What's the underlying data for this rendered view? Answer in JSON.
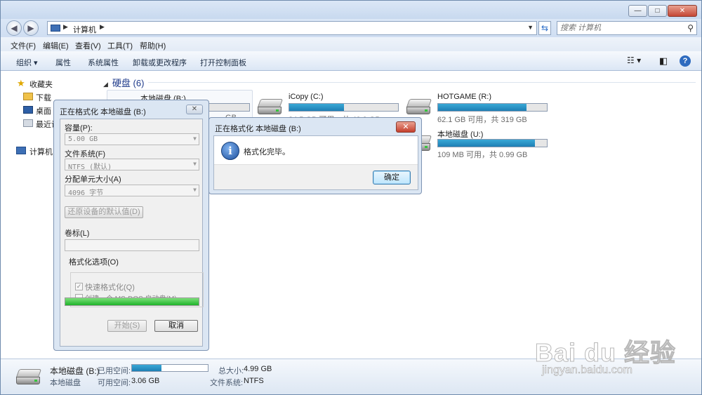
{
  "window": {
    "buttons": {
      "minimize": "—",
      "maximize": "□",
      "close": "✕"
    }
  },
  "address": {
    "path": "计算机",
    "search_placeholder": "搜索 计算机"
  },
  "menu": [
    "文件(F)",
    "编辑(E)",
    "查看(V)",
    "工具(T)",
    "帮助(H)"
  ],
  "toolbar": [
    "组织 ▾",
    "属性",
    "系统属性",
    "卸载或更改程序",
    "打开控制面板"
  ],
  "sidebar": {
    "favorites": "收藏夹",
    "items": [
      "下载",
      "桌面",
      "最近访"
    ],
    "computer": "计算机"
  },
  "group": {
    "title": "硬盘 (6)"
  },
  "drives": [
    {
      "name": "本地磁盘 (B:)",
      "usage": 0.0,
      "subtitle": "… GB"
    },
    {
      "name": "iCopy (C:)",
      "usage": 0.5,
      "subtitle": "24.5 GB 可用，共 49.9 GB"
    },
    {
      "name": "HOTGAME (R:)",
      "usage": 0.81,
      "subtitle": "62.1 GB 可用，共 319 GB"
    },
    {
      "name": "本地磁盘 (U:)",
      "usage": 0.89,
      "subtitle": "109 MB 可用，共 0.99 GB"
    }
  ],
  "details": {
    "name": "本地磁盘 (B:)",
    "type": "本地磁盘",
    "used_label": "已用空间:",
    "used_fraction": 0.39,
    "free_label": "可用空间:",
    "free_value": "3.06 GB",
    "total_label": "总大小:",
    "total_value": "4.99 GB",
    "fs_label": "文件系统:",
    "fs_value": "NTFS"
  },
  "format_dialog": {
    "title": "正在格式化 本地磁盘 (B:)",
    "close": "✕",
    "capacity_label": "容量(P):",
    "capacity_value": "5.00 GB",
    "fs_label": "文件系统(F)",
    "fs_value": "NTFS (默认)",
    "alloc_label": "分配单元大小(A)",
    "alloc_value": "4096 字节",
    "restore_btn": "还原设备的默认值(D)",
    "volume_label": "卷标(L)",
    "options_label": "格式化选项(O)",
    "quick_format": "快速格式化(Q)",
    "msdos": "创建一个 MS-DOS 启动盘(M)",
    "progress": 1.0,
    "start_btn": "开始(S)",
    "cancel_btn": "取消"
  },
  "message_box": {
    "title": "正在格式化 本地磁盘 (B:)",
    "close": "✕",
    "text": "格式化完毕。",
    "ok": "确定"
  },
  "watermark": {
    "line1": "Bai du 经验",
    "line2": "jingyan.baidu.com"
  }
}
